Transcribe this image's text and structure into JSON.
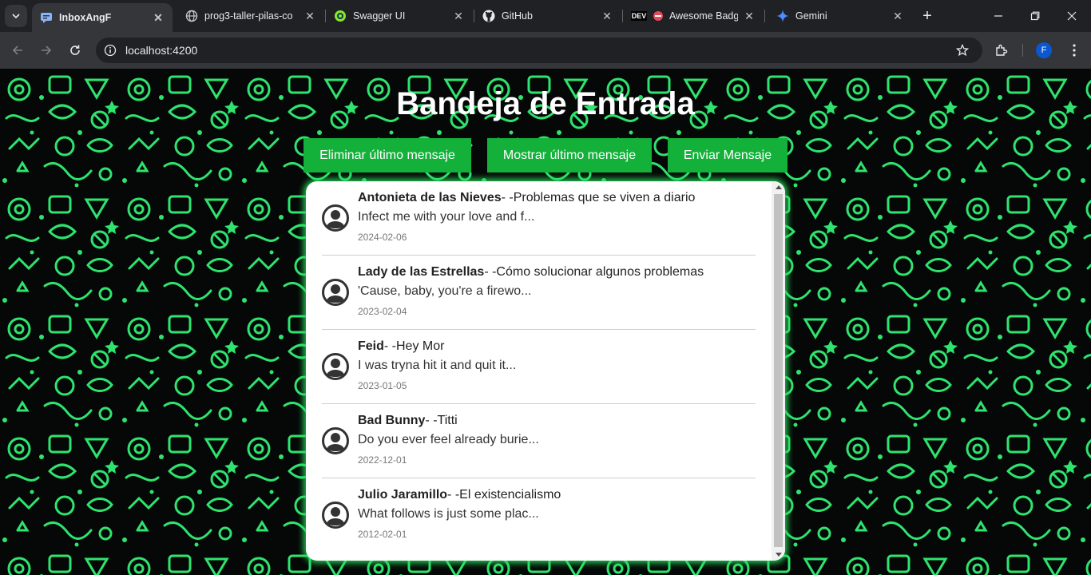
{
  "browser": {
    "tabs": [
      {
        "title": "InboxAngF",
        "icon": "chat-app-icon",
        "active": true
      },
      {
        "title": "prog3-taller-pilas-co",
        "icon": "globe-icon",
        "active": false
      },
      {
        "title": "Swagger UI",
        "icon": "swagger-icon",
        "active": false
      },
      {
        "title": "GitHub",
        "icon": "github-icon",
        "active": false
      },
      {
        "title": "Awesome Badge",
        "icon": "dev-icon",
        "active": false
      },
      {
        "title": "Gemini",
        "icon": "gemini-icon",
        "active": false
      }
    ],
    "dev_badge": "DEV",
    "address": "localhost:4200",
    "profile_initial": "F"
  },
  "page": {
    "title": "Bandeja de Entrada",
    "buttons": {
      "delete_last": "Eliminar último mensaje",
      "show_last": "Mostrar último mensaje",
      "send": "Enviar Mensaje"
    },
    "accent_color": "#13b13a",
    "messages": [
      {
        "sender": "Antonieta de las Nieves",
        "subject": "- -Problemas que se viven a diario",
        "preview": "Infect me with your love and f...",
        "date": "2024-02-06"
      },
      {
        "sender": "Lady de las Estrellas",
        "subject": "- -Cómo solucionar algunos problemas",
        "preview": "'Cause, baby, you're a firewo...",
        "date": "2023-02-04"
      },
      {
        "sender": "Feid",
        "subject": "- -Hey Mor",
        "preview": "I was tryna hit it and quit it...",
        "date": "2023-01-05"
      },
      {
        "sender": "Bad Bunny",
        "subject": "- -Titti",
        "preview": "Do you ever feel already burie...",
        "date": "2022-12-01"
      },
      {
        "sender": "Julio Jaramillo",
        "subject": "- -El existencialismo",
        "preview": "What follows is just some plac...",
        "date": "2012-02-01"
      }
    ]
  }
}
